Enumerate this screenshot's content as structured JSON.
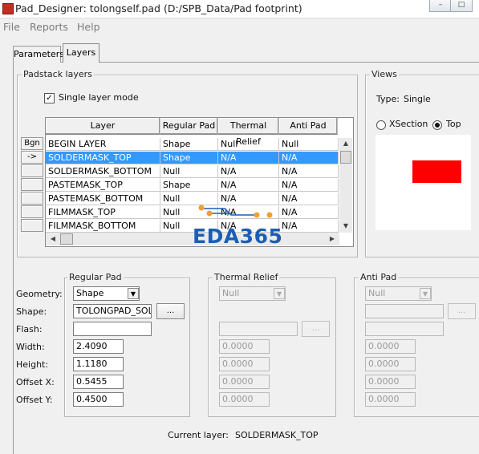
{
  "window": {
    "title": "Pad_Designer: tolongself.pad (D:/SPB_Data/Pad footprint)",
    "min_glyph": "–",
    "max_glyph": "□"
  },
  "menu": [
    "File",
    "Reports",
    "Help"
  ],
  "tabs": [
    {
      "label": "Parameters",
      "active": false
    },
    {
      "label": "Layers",
      "active": true
    }
  ],
  "padstack": {
    "group_title": "Padstack layers",
    "single_layer_mode_label": "Single layer mode",
    "single_layer_mode_checked": true,
    "check_glyph": "✓",
    "row_header_label": "Bgn",
    "row_arrow": "->",
    "columns": [
      "Layer",
      "Regular Pad",
      "Thermal Relief",
      "Anti Pad"
    ],
    "rows": [
      [
        "BEGIN LAYER",
        "Shape",
        "Null",
        "Null"
      ],
      [
        "SOLDERMASK_TOP",
        "Shape",
        "N/A",
        "N/A"
      ],
      [
        "SOLDERMASK_BOTTOM",
        "Null",
        "N/A",
        "N/A"
      ],
      [
        "PASTEMASK_TOP",
        "Shape",
        "N/A",
        "N/A"
      ],
      [
        "PASTEMASK_BOTTOM",
        "Null",
        "N/A",
        "N/A"
      ],
      [
        "FILMMASK_TOP",
        "Null",
        "N/A",
        "N/A"
      ],
      [
        "FILMMASK_BOTTOM",
        "Null",
        "N/A",
        "N/A"
      ]
    ],
    "selected_row_index": 1
  },
  "watermark": "EDA365",
  "views": {
    "group_title": "Views",
    "type_label": "Type:",
    "type_value": "Single",
    "xsection_label": "XSection",
    "top_label": "Top",
    "selected_view": "Top",
    "preview_shape_color": "#ff0000"
  },
  "labels": {
    "geometry": "Geometry:",
    "shape": "Shape:",
    "flash": "Flash:",
    "width": "Width:",
    "height": "Height:",
    "offset_x": "Offset X:",
    "offset_y": "Offset Y:"
  },
  "regular_pad": {
    "title": "Regular Pad",
    "geometry": "Shape",
    "shape": "TOLONGPAD_SOL",
    "flash": "",
    "width": "2.4090",
    "height": "1.1180",
    "offset_x": "0.5455",
    "offset_y": "0.4500",
    "browse_label": "..."
  },
  "thermal_relief": {
    "title": "Thermal Relief",
    "geometry": "Null",
    "browse_label": "...",
    "width": "0.0000",
    "height": "0.0000",
    "offset_x": "0.0000",
    "offset_y": "0.0000"
  },
  "anti_pad": {
    "title": "Anti Pad",
    "geometry": "Null",
    "browse_label": "...",
    "width": "0.0000",
    "height": "0.0000",
    "offset_x": "0.0000",
    "offset_y": "0.0000"
  },
  "current_layer": {
    "label": "Current layer:",
    "value": "SOLDERMASK_TOP"
  },
  "colors": {
    "selection": "#3399ff",
    "watermark": "#1a5fb4",
    "watermark_dots": "#f0a030"
  }
}
